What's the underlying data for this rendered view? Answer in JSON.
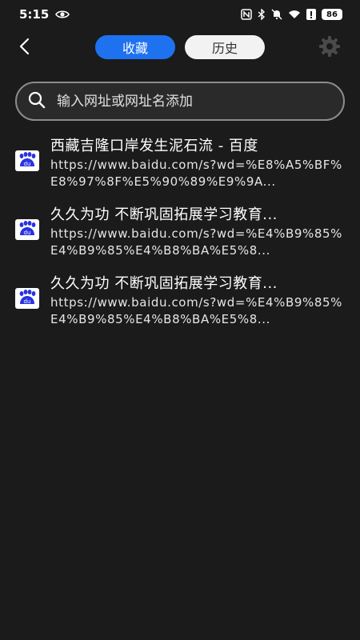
{
  "status_bar": {
    "time": "5:15",
    "battery": "86"
  },
  "header": {
    "back_icon": "chevron-left-icon",
    "tabs": [
      {
        "label": "收藏",
        "active": true
      },
      {
        "label": "历史",
        "active": false
      }
    ],
    "settings_icon": "gear-icon"
  },
  "search": {
    "placeholder": "输入网址或网址名添加",
    "value": ""
  },
  "colors": {
    "accent": "#1e72f0",
    "background": "#1b1b1b",
    "favicon_blue": "#2932e1"
  },
  "bookmarks": [
    {
      "title": "西藏吉隆口岸发生泥石流 - 百度",
      "url": "https://www.baidu.com/s?wd=%E8%A5%BF%E8%97%8F%E5%90%89%E9%9A...",
      "icon": "baidu-icon"
    },
    {
      "title": "久久为功 不断巩固拓展学习教育...",
      "url": "https://www.baidu.com/s?wd=%E4%B9%85%E4%B9%85%E4%B8%BA%E5%8...",
      "icon": "baidu-icon"
    },
    {
      "title": "久久为功 不断巩固拓展学习教育...",
      "url": "https://www.baidu.com/s?wd=%E4%B9%85%E4%B9%85%E4%B8%BA%E5%8...",
      "icon": "baidu-icon"
    }
  ]
}
